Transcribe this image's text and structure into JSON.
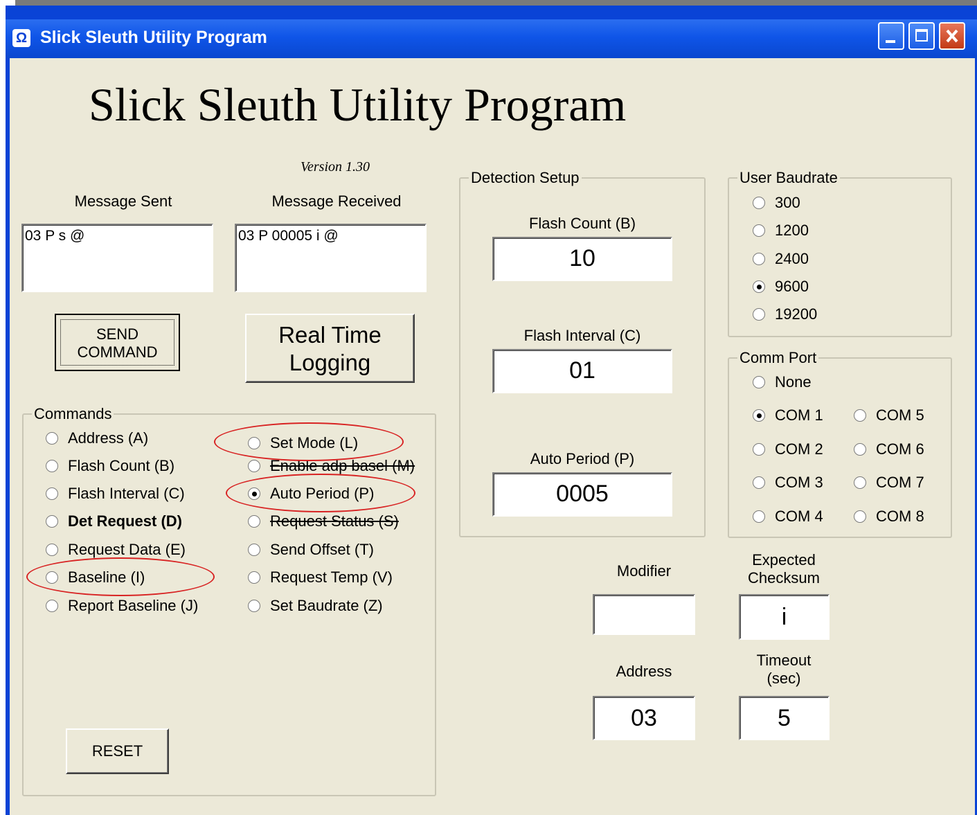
{
  "window": {
    "title": "Slick Sleuth Utility Program",
    "icon": "Ω"
  },
  "header": {
    "big_title": "Slick Sleuth Utility Program",
    "version": "Version 1.30"
  },
  "messages": {
    "sent_label": "Message Sent",
    "sent_value": "03 P s @",
    "received_label": "Message Received",
    "received_value": "03 P 00005 i @"
  },
  "buttons": {
    "send_line1": "SEND",
    "send_line2": "COMMAND",
    "realtime_line1": "Real Time",
    "realtime_line2": "Logging",
    "reset": "RESET"
  },
  "commands": {
    "label": "Commands",
    "left": [
      {
        "label": "Address (A)",
        "checked": false
      },
      {
        "label": "Flash Count (B)",
        "checked": false
      },
      {
        "label": "Flash Interval (C)",
        "checked": false
      },
      {
        "label": "Det Request (D)",
        "checked": false
      },
      {
        "label": "Request Data (E)",
        "checked": false
      },
      {
        "label": "Baseline (I)",
        "checked": false
      },
      {
        "label": "Report Baseline (J)",
        "checked": false
      }
    ],
    "right": [
      {
        "label": "Set Mode (L)",
        "checked": false
      },
      {
        "label": "Enable adp basel (M)",
        "checked": false
      },
      {
        "label": "Auto Period (P)",
        "checked": true
      },
      {
        "label": "Request Status (S)",
        "checked": false
      },
      {
        "label": "Send Offset (T)",
        "checked": false
      },
      {
        "label": "Request Temp (V)",
        "checked": false
      },
      {
        "label": "Set Baudrate (Z)",
        "checked": false
      }
    ]
  },
  "detection": {
    "label": "Detection Setup",
    "flash_count_label": "Flash Count (B)",
    "flash_count_value": "10",
    "flash_interval_label": "Flash Interval (C)",
    "flash_interval_value": "01",
    "auto_period_label": "Auto Period (P)",
    "auto_period_value": "0005"
  },
  "baudrate": {
    "label": "User Baudrate",
    "options": [
      {
        "label": "300",
        "checked": false
      },
      {
        "label": "1200",
        "checked": false
      },
      {
        "label": "2400",
        "checked": false
      },
      {
        "label": "9600",
        "checked": true
      },
      {
        "label": "19200",
        "checked": false
      }
    ]
  },
  "comm_port": {
    "label": "Comm Port",
    "none": "None",
    "ports": [
      {
        "label": "COM 1",
        "checked": true
      },
      {
        "label": "COM 2",
        "checked": false
      },
      {
        "label": "COM 3",
        "checked": false
      },
      {
        "label": "COM 4",
        "checked": false
      },
      {
        "label": "COM 5",
        "checked": false
      },
      {
        "label": "COM 6",
        "checked": false
      },
      {
        "label": "COM 7",
        "checked": false
      },
      {
        "label": "COM 8",
        "checked": false
      }
    ]
  },
  "fields": {
    "modifier_label": "Modifier",
    "modifier_value": "",
    "checksum_label_1": "Expected",
    "checksum_label_2": "Checksum",
    "checksum_value": "i",
    "address_label": "Address",
    "address_value": "03",
    "timeout_label_1": "Timeout",
    "timeout_label_2": "(sec)",
    "timeout_value": "5"
  },
  "annotation_color": "#d82323"
}
